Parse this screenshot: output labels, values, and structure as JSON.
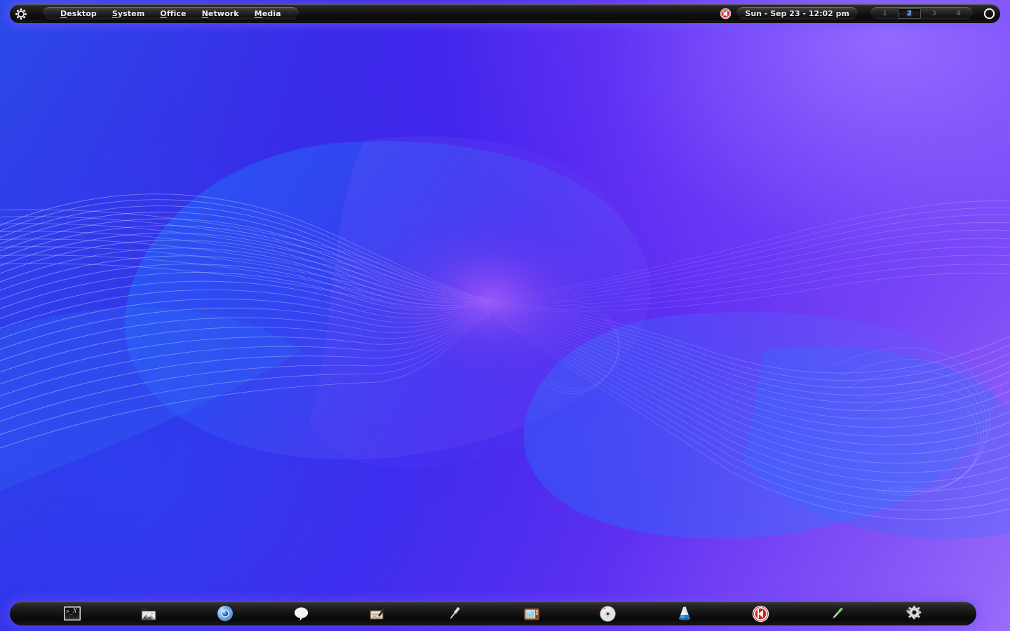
{
  "desktop": {
    "wallpaper_name": "abstract-wave-ribbon-wallpaper",
    "colors": {
      "gradient_start": "#2b4ce8",
      "gradient_mid": "#4a20ef",
      "gradient_end": "#9a6bfa",
      "ribbon_blue": "#0a84ff",
      "line_stroke": "#c8c8ff",
      "panel_bg": "#111111",
      "panel_glow": "#7a5aff",
      "active_desk_text": "#7db8ff",
      "inactive_desk_text": "#5e5e5e"
    }
  },
  "top_panel": {
    "gear_icon": "gear-icon",
    "menu": {
      "items": [
        {
          "label": "Desktop",
          "accel": "D",
          "rest": "esktop"
        },
        {
          "label": "System",
          "accel": "S",
          "rest": "ystem"
        },
        {
          "label": "Office",
          "accel": "O",
          "rest": "ffice"
        },
        {
          "label": "Network",
          "accel": "N",
          "rest": "etwork"
        },
        {
          "label": "Media",
          "accel": "M",
          "rest": "edia"
        }
      ]
    },
    "tray": {
      "icon": "media-player-tray-icon"
    },
    "clock": {
      "text": "Sun - Sep 23 - 12:02 pm"
    },
    "pager": {
      "desktops": [
        {
          "label": "1",
          "active": false
        },
        {
          "label": "2",
          "active": true
        },
        {
          "label": "3",
          "active": false
        },
        {
          "label": "4",
          "active": false
        }
      ]
    },
    "logout": {
      "icon": "power-circle-icon",
      "label": "Logout"
    }
  },
  "dock": {
    "items": [
      {
        "icon": "terminal-icon",
        "label": "Terminal",
        "prompt": ">_X"
      },
      {
        "icon": "file-manager-icon",
        "label": "File Manager"
      },
      {
        "icon": "chromium-browser-icon",
        "label": "Chromium"
      },
      {
        "icon": "chat-bubble-icon",
        "label": "Chat"
      },
      {
        "icon": "text-editor-icon",
        "label": "Text Editor"
      },
      {
        "icon": "screwdriver-icon",
        "label": "Tools"
      },
      {
        "icon": "television-icon",
        "label": "TV"
      },
      {
        "icon": "cd-burner-icon",
        "label": "Disc Burner"
      },
      {
        "icon": "vlc-cone-icon",
        "label": "VLC Media Player"
      },
      {
        "icon": "media-player-icon",
        "label": "Media Player"
      },
      {
        "icon": "eyedropper-icon",
        "label": "Color Picker"
      },
      {
        "icon": "settings-gear-wrench-icon",
        "label": "System Settings"
      }
    ]
  }
}
